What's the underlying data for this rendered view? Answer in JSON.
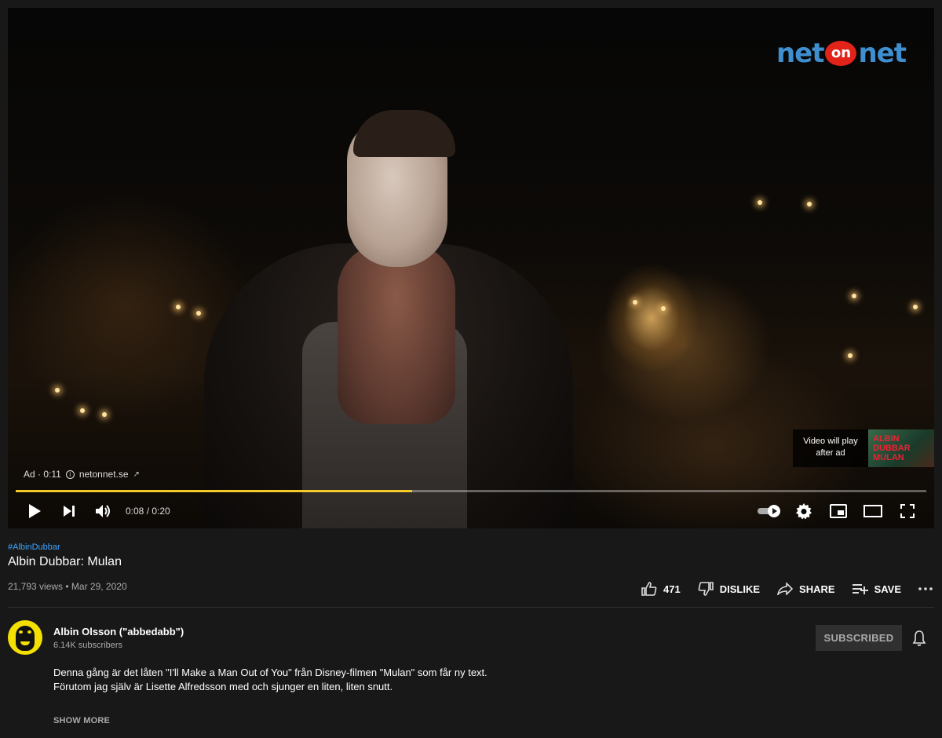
{
  "player": {
    "brand": {
      "left": "net",
      "middle": "on",
      "right": "net"
    },
    "ad": {
      "label": "Ad · 0:11",
      "advertiser_link": "netonnet.se"
    },
    "up_next": {
      "text_line1": "Video will play",
      "text_line2": "after ad",
      "thumb_text": "ALBIN DUBBAR MULAN"
    },
    "progress": 0.435,
    "progress_color": "#f4c92a",
    "time": "0:08 / 0:20",
    "controls": [
      "play-icon",
      "next-icon",
      "volume-icon",
      "autoplay-toggle",
      "settings-icon",
      "miniplayer-icon",
      "theater-icon",
      "fullscreen-icon"
    ]
  },
  "video": {
    "hashtag": "#AlbinDubbar",
    "title": "Albin Dubbar: Mulan",
    "meta": "21,793 views • Mar 29, 2020"
  },
  "actions": {
    "like_count": "471",
    "dislike_label": "DISLIKE",
    "share_label": "SHARE",
    "save_label": "SAVE"
  },
  "channel": {
    "name": "Albin Olsson (\"abbedabb\")",
    "subscribers": "6.14K subscribers",
    "subscribe_label": "SUBSCRIBED"
  },
  "description": {
    "line1": "Denna gång är det låten \"I'll Make a Man Out of You\" från Disney-filmen \"Mulan\" som får ny text.",
    "line2": "Förutom jag själv är Lisette Alfredsson med och sjunger en liten, liten snutt.",
    "show_more": "SHOW MORE"
  },
  "colors": {
    "background": "#181818",
    "link": "#3ea6ff",
    "accent_ad": "#f4c92a"
  }
}
